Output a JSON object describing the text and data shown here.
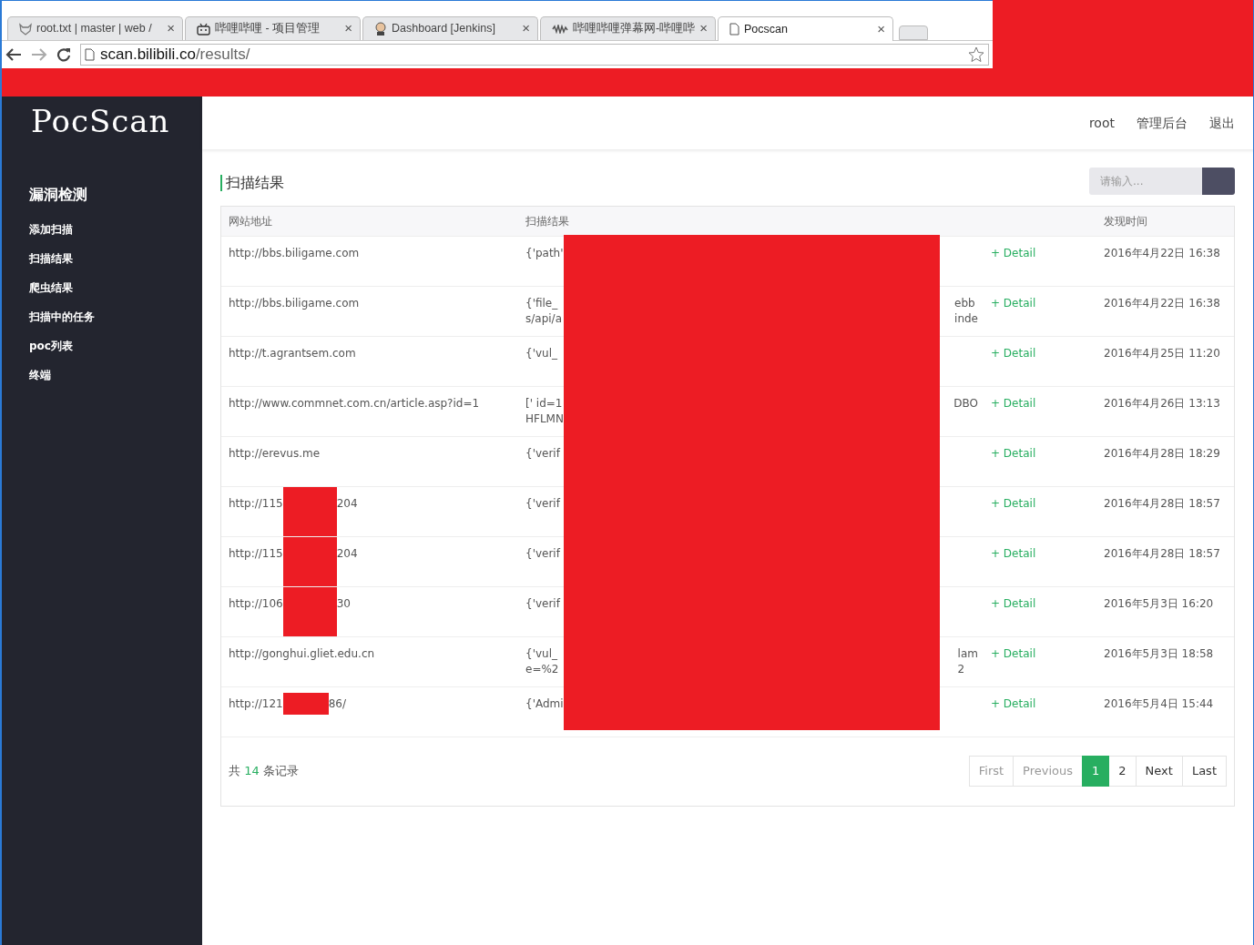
{
  "browser": {
    "tabs": [
      {
        "label": "root.txt | master | web /",
        "selected": false
      },
      {
        "label": "哔哩哔哩 - 项目管理",
        "selected": false
      },
      {
        "label": "Dashboard [Jenkins]",
        "selected": false
      },
      {
        "label": "哔哩哔哩弹幕网-哔哩哔",
        "selected": false
      },
      {
        "label": "Pocscan",
        "selected": true
      }
    ],
    "close_glyph": "×",
    "address": {
      "host": "scan.bilibili.co",
      "path": "/results/"
    },
    "redacted_right": true
  },
  "app": {
    "logo": "PocScan",
    "sidebar": {
      "heading": "漏洞检测",
      "items": [
        {
          "label": "添加扫描",
          "selected": false
        },
        {
          "label": "扫描结果",
          "selected": false
        },
        {
          "label": "爬虫结果",
          "selected": false
        },
        {
          "label": "扫描中的任务",
          "selected": false
        },
        {
          "label": "poc列表",
          "selected": false
        },
        {
          "label": "终端",
          "selected": false
        }
      ]
    },
    "topnav": [
      "root",
      "管理后台",
      "退出"
    ],
    "page_title": "扫描结果",
    "search": {
      "placeholder": "请输入..."
    },
    "table": {
      "columns": [
        "网站地址",
        "扫描结果",
        "",
        "发现时间"
      ],
      "results_redacted": true,
      "rows": [
        {
          "url_start": "http://bbs.biligame.com",
          "url_redacted": false,
          "result_start": [
            "{'path'"
          ],
          "result_end": [],
          "detail": "+ Detail",
          "time": "2016年4月22日 16:38"
        },
        {
          "url_start": "http://bbs.biligame.com",
          "url_redacted": false,
          "result_start": [
            "{'file_",
            "s/api/a"
          ],
          "result_end": [
            "ebb",
            "inde"
          ],
          "detail": "+ Detail",
          "time": "2016年4月22日 16:38"
        },
        {
          "url_start": "http://t.agrantsem.com",
          "url_redacted": false,
          "result_start": [
            "{'vul_"
          ],
          "result_end": [],
          "detail": "+ Detail",
          "time": "2016年4月25日 11:20"
        },
        {
          "url_start": "http://www.commnet.com.cn/article.asp?id=1",
          "url_redacted": false,
          "result_start": [
            "[' id=1",
            "HFLMN"
          ],
          "result_end": [
            "DBO"
          ],
          "detail": "+ Detail",
          "time": "2016年4月26日 13:13"
        },
        {
          "url_start": "http://erevus.me",
          "url_redacted": false,
          "result_start": [
            "{'verif"
          ],
          "result_end": [],
          "detail": "+ Detail",
          "time": "2016年4月28日 18:29"
        },
        {
          "url_start": "http://115",
          "url_redacted": true,
          "url_end": "204",
          "result_start": [
            "{'verif"
          ],
          "result_end": [],
          "detail": "+ Detail",
          "time": "2016年4月28日 18:57"
        },
        {
          "url_start": "http://115",
          "url_redacted": true,
          "url_end": "204",
          "result_start": [
            "{'verif"
          ],
          "result_end": [],
          "detail": "+ Detail",
          "time": "2016年4月28日 18:57"
        },
        {
          "url_start": "http://106",
          "url_redacted": true,
          "url_end": "30",
          "result_start": [
            "{'verif"
          ],
          "result_end": [],
          "detail": "+ Detail",
          "time": "2016年5月3日 16:20"
        },
        {
          "url_start": "http://gonghui.gliet.edu.cn",
          "url_redacted": false,
          "result_start": [
            "{'vul_",
            "e=%2"
          ],
          "result_end": [
            "lam",
            "2"
          ],
          "detail": "+ Detail",
          "time": "2016年5月3日 18:58"
        },
        {
          "url_start": "http://121",
          "url_redacted": true,
          "url_end": "86/",
          "result_start": [
            "{'Admi"
          ],
          "result_end": [],
          "detail": "+ Detail",
          "time": "2016年5月4日 15:44"
        }
      ]
    },
    "records": {
      "prefix": "共",
      "count": "14",
      "suffix": "条记录"
    },
    "pagination": [
      {
        "label": "First",
        "selected": false,
        "disabled": true
      },
      {
        "label": "Previous",
        "selected": false,
        "disabled": true
      },
      {
        "label": "1",
        "selected": true,
        "disabled": false
      },
      {
        "label": "2",
        "selected": false,
        "disabled": false
      },
      {
        "label": "Next",
        "selected": false,
        "disabled": false
      },
      {
        "label": "Last",
        "selected": false,
        "disabled": false
      }
    ]
  }
}
